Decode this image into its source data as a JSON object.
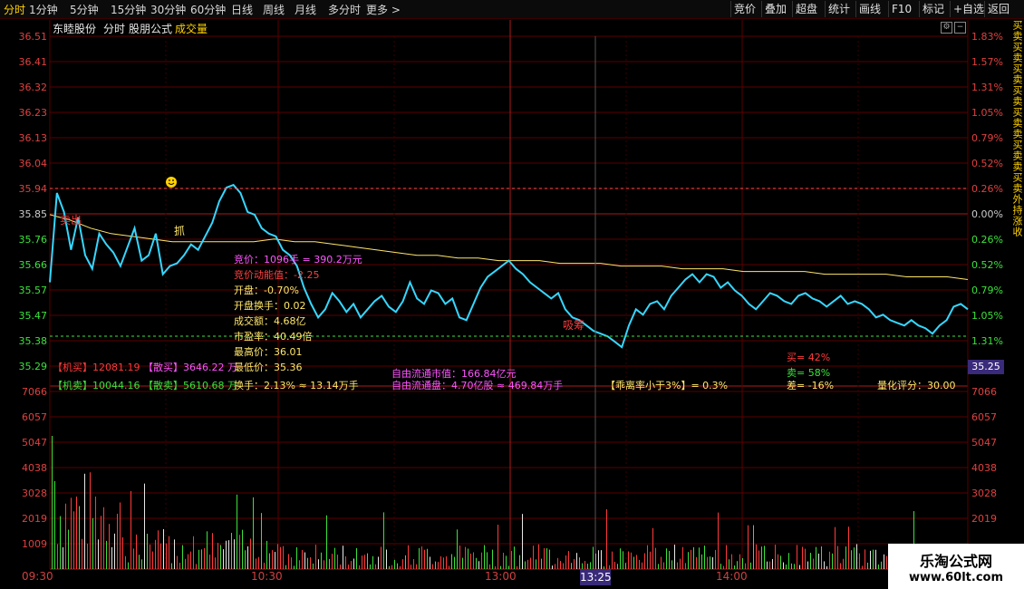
{
  "toolbar": {
    "tabs": [
      "分时",
      "1分钟",
      "5分钟",
      "15分钟",
      "30分钟",
      "60分钟",
      "日线",
      "周线",
      "月线",
      "多分时",
      "更多 >"
    ],
    "buttons": [
      "竞价",
      "叠加",
      "超盘",
      "统计",
      "画线",
      "F10",
      "标记",
      "+自选",
      "返回"
    ]
  },
  "chart_header": {
    "stock_name": "东睦股份",
    "view": "分时",
    "formula": "股朋公式",
    "indicator": "成交量"
  },
  "price_axis_left": [
    "36.51",
    "36.41",
    "36.32",
    "36.23",
    "36.13",
    "36.04",
    "35.94",
    "35.85",
    "35.76",
    "35.66",
    "35.57",
    "35.47",
    "35.38",
    "35.29"
  ],
  "price_axis_right": [
    "1.83%",
    "1.57%",
    "1.31%",
    "1.05%",
    "0.79%",
    "0.52%",
    "0.26%",
    "0.00%",
    "0.26%",
    "0.52%",
    "0.79%",
    "1.05%",
    "1.31%"
  ],
  "volume_axis": [
    "7066",
    "6057",
    "5047",
    "4038",
    "3028",
    "2019",
    "1009"
  ],
  "time_axis": [
    "09:30",
    "10:30",
    "13:00",
    "14:00"
  ],
  "cursor": {
    "price": "35.25",
    "time": "13:25"
  },
  "stats": {
    "auction_price": "竞价：1096手 = 390.2万元",
    "auction_momentum": "竞价动能值：-2.25",
    "open": "开盘：-0.70%",
    "open_turnover": "开盘换手：0.02",
    "amount": "成交额：4.68亿",
    "pe": "市盈率：40.49倍",
    "high": "最高价：36.01",
    "low": "最低价：35.36",
    "turnover": "换手：2.13% ≈ 13.14万手",
    "float_mv": "自由流通市值：166.84亿元",
    "float_shares": "自由流通盘：4.70亿股 ≈ 469.84万手",
    "deviation": "【乖离率小于3%】= 0.3%",
    "score": "量化评分：30.00"
  },
  "flows": {
    "inst_buy": "【机买】12081.19",
    "retail_buy": "【散买】3646.22 万",
    "inst_sell": "【机卖】10044.16",
    "retail_sell": "【散卖】5610.68 万",
    "buy_pct": "买= 42%",
    "sell_pct": "卖= 58%",
    "diff_pct": "差= -16%"
  },
  "markers": {
    "grab": "抓",
    "sell": "卖出",
    "chip": "吸筹"
  },
  "side_text": "买卖买卖买卖买卖买卖卖买卖卖买卖外持涨收",
  "watermark": {
    "name": "乐淘公式网",
    "url": "www.60lt.com"
  },
  "colors": {
    "price_line": "#35d7ff",
    "avg_line": "#ffe66a",
    "up": "#ff3a3a",
    "down": "#3be23b",
    "grid": "#5a0000"
  },
  "chart_data": {
    "type": "line",
    "price": [
      35.6,
      35.93,
      35.86,
      35.72,
      35.84,
      35.7,
      35.65,
      35.78,
      35.74,
      35.71,
      35.66,
      35.73,
      35.8,
      35.68,
      35.7,
      35.78,
      35.63,
      35.66,
      35.67,
      35.7,
      35.74,
      35.72,
      35.77,
      35.82,
      35.9,
      35.95,
      35.96,
      35.93,
      35.86,
      35.85,
      35.8,
      35.78,
      35.77,
      35.72,
      35.7,
      35.66,
      35.58,
      35.52,
      35.47,
      35.5,
      35.56,
      35.53,
      35.49,
      35.52,
      35.47,
      35.5,
      35.53,
      35.55,
      35.51,
      35.49,
      35.53,
      35.6,
      35.54,
      35.52,
      35.57,
      35.56,
      35.52,
      35.54,
      35.47,
      35.46,
      35.52,
      35.58,
      35.62,
      35.64,
      35.66,
      35.68,
      35.65,
      35.63,
      35.6,
      35.58,
      35.56,
      35.54,
      35.56,
      35.5,
      35.47,
      35.46,
      35.44,
      35.42,
      35.41,
      35.4,
      35.38,
      35.36,
      35.44,
      35.5,
      35.48,
      35.52,
      35.53,
      35.5,
      35.55,
      35.58,
      35.61,
      35.63,
      35.6,
      35.63,
      35.62,
      35.58,
      35.6,
      35.57,
      35.55,
      35.52,
      35.5,
      35.53,
      35.56,
      35.55,
      35.53,
      35.52,
      35.55,
      35.56,
      35.54,
      35.53,
      35.51,
      35.53,
      35.55,
      35.52,
      35.53,
      35.52,
      35.5,
      35.47,
      35.48,
      35.46,
      35.45,
      35.44,
      35.46,
      35.44,
      35.43,
      35.41,
      35.44,
      35.46,
      35.51,
      35.52,
      35.5
    ],
    "avg": [
      35.85,
      35.83,
      35.8,
      35.78,
      35.77,
      35.76,
      35.75,
      35.75,
      35.75,
      35.75,
      35.75,
      35.76,
      35.75,
      35.75,
      35.74,
      35.73,
      35.72,
      35.71,
      35.7,
      35.7,
      35.69,
      35.69,
      35.68,
      35.68,
      35.68,
      35.67,
      35.67,
      35.67,
      35.66,
      35.66,
      35.66,
      35.65,
      35.65,
      35.65,
      35.64,
      35.64,
      35.64,
      35.64,
      35.63,
      35.63,
      35.63,
      35.63,
      35.62,
      35.62,
      35.62,
      35.61
    ]
  }
}
